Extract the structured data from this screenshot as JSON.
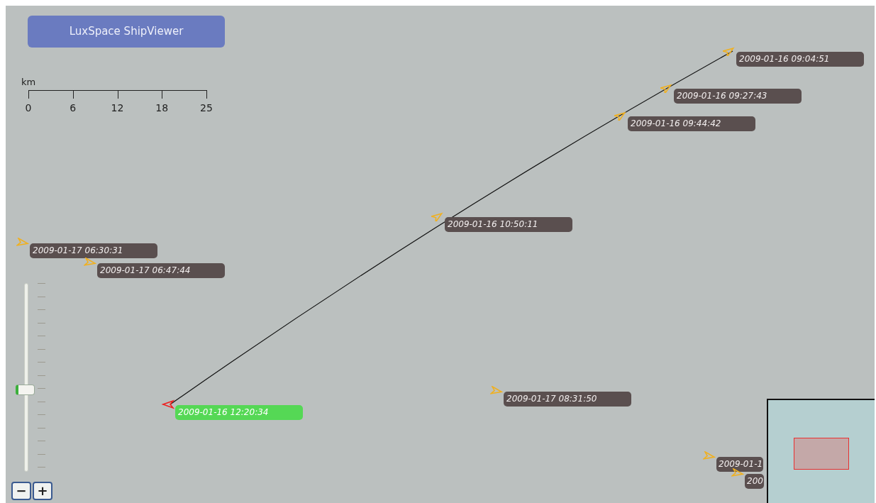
{
  "title_button": "LuxSpace ShipViewer",
  "scale_bar": {
    "unit": "km",
    "ticks": [
      "0",
      "6",
      "12",
      "18",
      "25"
    ]
  },
  "zoom_slider": {
    "level": 0.43,
    "zoom_out": "−",
    "zoom_in": "+"
  },
  "ships": [
    {
      "label": "2009-01-16 09:04:51",
      "selected": false
    },
    {
      "label": "2009-01-16 09:27:43",
      "selected": false
    },
    {
      "label": "2009-01-16 09:44:42",
      "selected": false
    },
    {
      "label": "2009-01-16 10:50:11",
      "selected": false
    },
    {
      "label": "2009-01-17 06:30:31",
      "selected": false
    },
    {
      "label": "2009-01-17 06:47:44",
      "selected": false
    },
    {
      "label": "2009-01-16 12:20:34",
      "selected": true
    },
    {
      "label": "2009-01-17 08:31:50",
      "selected": false
    },
    {
      "label": "2009-01-1",
      "selected": false
    },
    {
      "label": "200",
      "selected": false
    }
  ]
}
